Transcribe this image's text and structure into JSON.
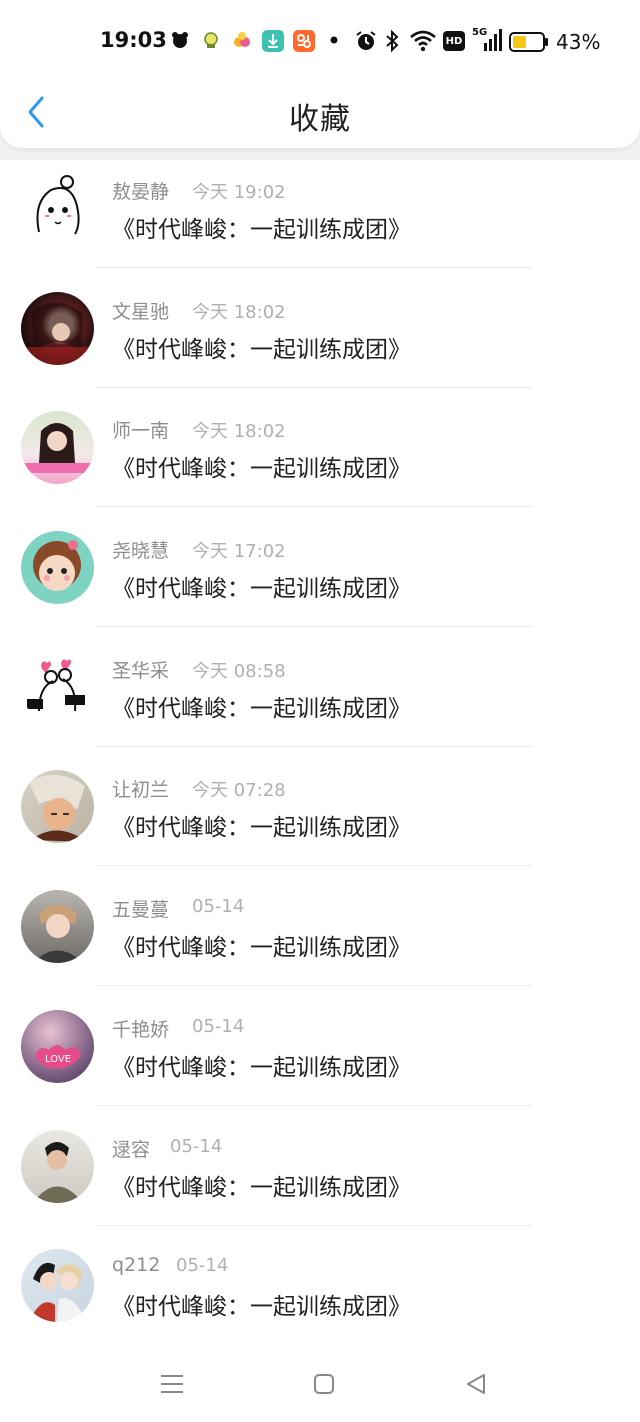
{
  "status_bar": {
    "time": "19:03",
    "battery_percent": "43%",
    "icons": [
      "app-notification-icon",
      "app-notification-icon",
      "app-notification-icon",
      "download-icon",
      "app-notification-icon",
      "dot-icon",
      "alarm-icon",
      "bluetooth-icon",
      "wifi-icon",
      "hd-icon",
      "signal-5g-icon",
      "battery-icon"
    ],
    "hd_label": "HD",
    "signal_label": "5G",
    "accent_colors": {
      "battery_fill": "#f5c518",
      "download_badge": "#3ec1b0",
      "app_badge": "#ff6a2a"
    }
  },
  "header": {
    "title": "收藏",
    "back_icon": "chevron-left-icon",
    "accent": "#2a9bf0"
  },
  "items": [
    {
      "name": "敖晏静",
      "time": "今天 19:02",
      "message": "《时代峰峻：一起训练成团》"
    },
    {
      "name": "文星驰",
      "time": "今天 18:02",
      "message": "《时代峰峻：一起训练成团》"
    },
    {
      "name": "师一南",
      "time": "今天 18:02",
      "message": "《时代峰峻：一起训练成团》"
    },
    {
      "name": "尧晓慧",
      "time": "今天 17:02",
      "message": "《时代峰峻：一起训练成团》"
    },
    {
      "name": "圣华采",
      "time": "今天 08:58",
      "message": "《时代峰峻：一起训练成团》"
    },
    {
      "name": "让初兰",
      "time": "今天 07:28",
      "message": "《时代峰峻：一起训练成团》"
    },
    {
      "name": "五曼蔓",
      "time": "05-14",
      "message": "《时代峰峻：一起训练成团》"
    },
    {
      "name": "千艳娇",
      "time": "05-14",
      "message": "《时代峰峻：一起训练成团》"
    },
    {
      "name": "逯容",
      "time": "05-14",
      "message": "《时代峰峻：一起训练成团》"
    },
    {
      "name": "q212",
      "time": "05-14",
      "message": "《时代峰峻：一起训练成团》"
    }
  ],
  "nav": {
    "menu_icon": "menu-icon",
    "home_icon": "home-square-icon",
    "back_icon": "back-triangle-icon"
  }
}
